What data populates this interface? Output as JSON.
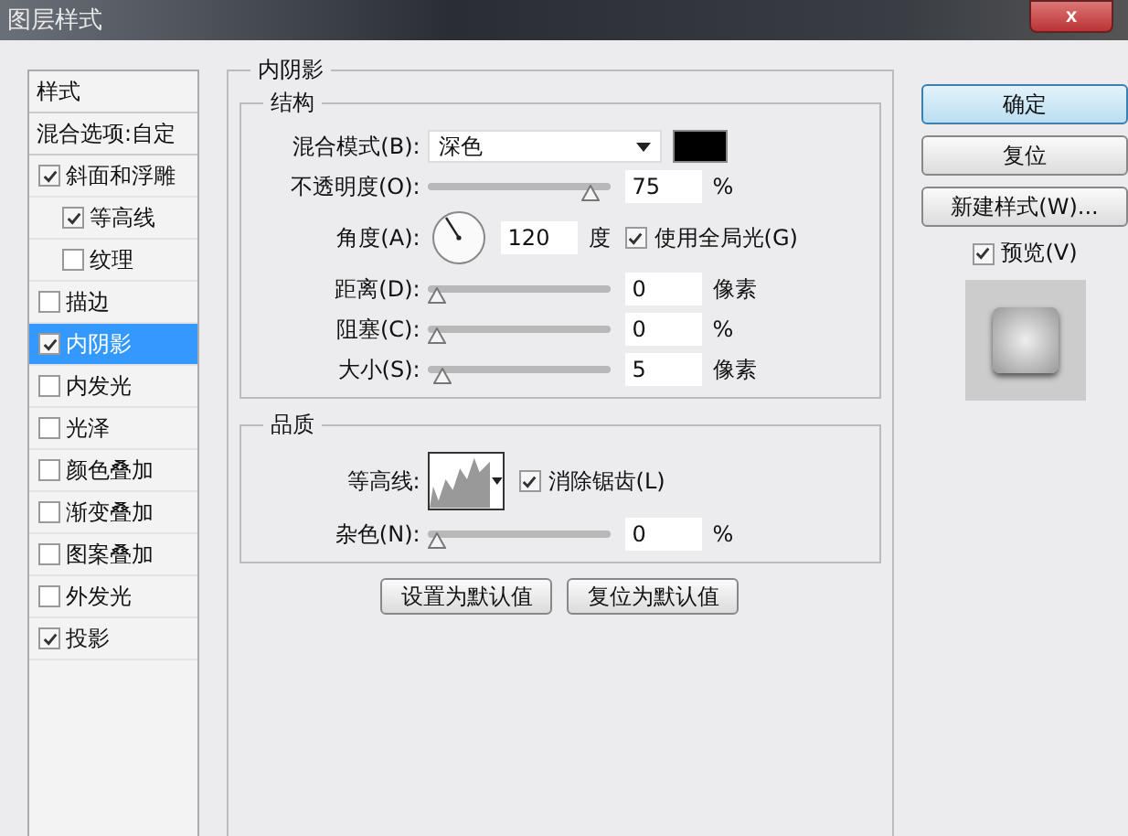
{
  "window": {
    "title": "图层样式",
    "close": "x"
  },
  "styles_list": {
    "header": "样式",
    "blend_options": "混合选项:自定",
    "items": [
      {
        "label": "斜面和浮雕",
        "checked": true,
        "selected": false,
        "children": [
          {
            "label": "等高线",
            "checked": true,
            "selected": false
          },
          {
            "label": "纹理",
            "checked": false,
            "selected": false
          }
        ]
      },
      {
        "label": "描边",
        "checked": false,
        "selected": false
      },
      {
        "label": "内阴影",
        "checked": true,
        "selected": true
      },
      {
        "label": "内发光",
        "checked": false,
        "selected": false
      },
      {
        "label": "光泽",
        "checked": false,
        "selected": false
      },
      {
        "label": "颜色叠加",
        "checked": false,
        "selected": false
      },
      {
        "label": "渐变叠加",
        "checked": false,
        "selected": false
      },
      {
        "label": "图案叠加",
        "checked": false,
        "selected": false
      },
      {
        "label": "外发光",
        "checked": false,
        "selected": false
      },
      {
        "label": "投影",
        "checked": true,
        "selected": false
      }
    ]
  },
  "panel": {
    "title": "内阴影",
    "structure": {
      "title": "结构",
      "rows": [
        {
          "kind": "blend",
          "label": "混合模式(B):",
          "value": "深色",
          "color": "#000000"
        },
        {
          "kind": "slider",
          "label": "不透明度(O):",
          "level": 0.88,
          "value": "75",
          "unit": "%"
        },
        {
          "kind": "angle",
          "label": "角度(A):",
          "value": "120",
          "unit": "度",
          "checkbox": {
            "label": "使用全局光(G)",
            "checked": true
          }
        },
        {
          "kind": "slider",
          "label": "距离(D):",
          "level": 0,
          "value": "0",
          "unit": "像素"
        },
        {
          "kind": "slider",
          "label": "阻塞(C):",
          "level": 0,
          "value": "0",
          "unit": "%"
        },
        {
          "kind": "slider",
          "label": "大小(S):",
          "level": 0.03,
          "value": "5",
          "unit": "像素"
        }
      ]
    },
    "quality": {
      "title": "品质",
      "contour_label": "等高线:",
      "anti_alias": {
        "label": "消除锯齿(L)",
        "checked": true
      },
      "noise": {
        "label": "杂色(N):",
        "level": 0,
        "value": "0",
        "unit": "%"
      }
    },
    "buttons": [
      "设置为默认值",
      "复位为默认值"
    ]
  },
  "side": {
    "buttons": [
      {
        "label": "确定",
        "default": true
      },
      {
        "label": "复位",
        "default": false
      },
      {
        "label": "新建样式(W)...",
        "default": false
      }
    ],
    "preview": {
      "label": "预览(V)",
      "checked": true
    }
  }
}
